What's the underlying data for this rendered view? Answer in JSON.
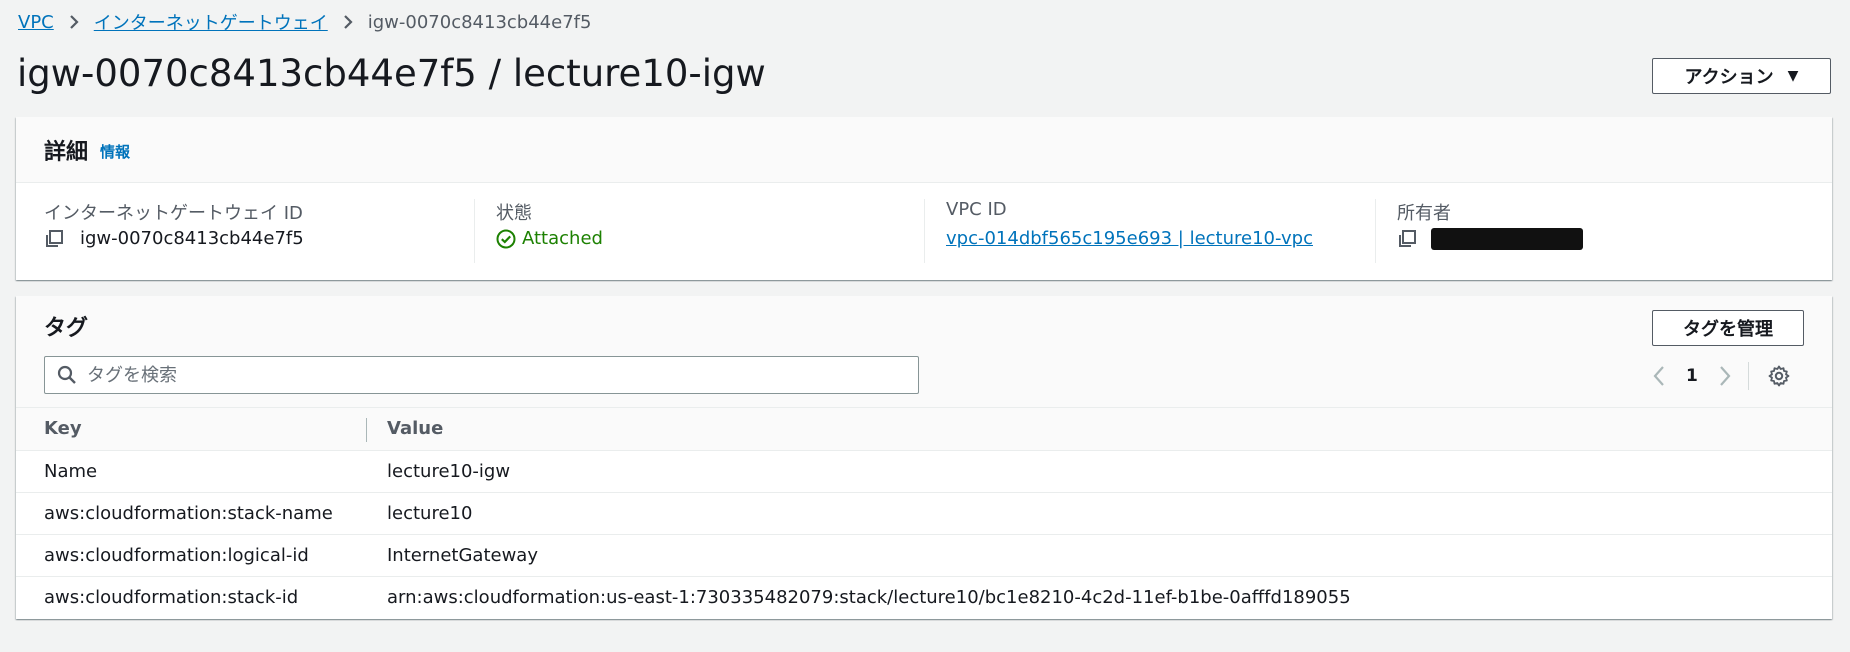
{
  "breadcrumb": {
    "items": [
      "VPC",
      "インターネットゲートウェイ"
    ],
    "current": "igw-0070c8413cb44e7f5"
  },
  "page": {
    "title": "igw-0070c8413cb44e7f5 / lecture10-igw",
    "actions_label": "アクション"
  },
  "details": {
    "heading": "詳細",
    "info_link": "情報",
    "fields": {
      "igw_id": {
        "label": "インターネットゲートウェイ ID",
        "value": "igw-0070c8413cb44e7f5"
      },
      "state": {
        "label": "状態",
        "value": "Attached"
      },
      "vpc_id": {
        "label": "VPC ID",
        "value": "vpc-014dbf565c195e693 | lecture10-vpc"
      },
      "owner": {
        "label": "所有者"
      }
    }
  },
  "tags": {
    "heading": "タグ",
    "manage_label": "タグを管理",
    "search_placeholder": "タグを検索",
    "page_number": "1",
    "columns": [
      "Key",
      "Value"
    ],
    "rows": [
      {
        "key": "Name",
        "value": "lecture10-igw"
      },
      {
        "key": "aws:cloudformation:stack-name",
        "value": "lecture10"
      },
      {
        "key": "aws:cloudformation:logical-id",
        "value": "InternetGateway"
      },
      {
        "key": "aws:cloudformation:stack-id",
        "value": "arn:aws:cloudformation:us-east-1:730335482079:stack/lecture10/bc1e8210-4c2d-11ef-b1be-0afffd189055"
      }
    ]
  },
  "colors": {
    "link": "#0073bb",
    "success": "#1d8102",
    "background": "#f2f3f3"
  }
}
